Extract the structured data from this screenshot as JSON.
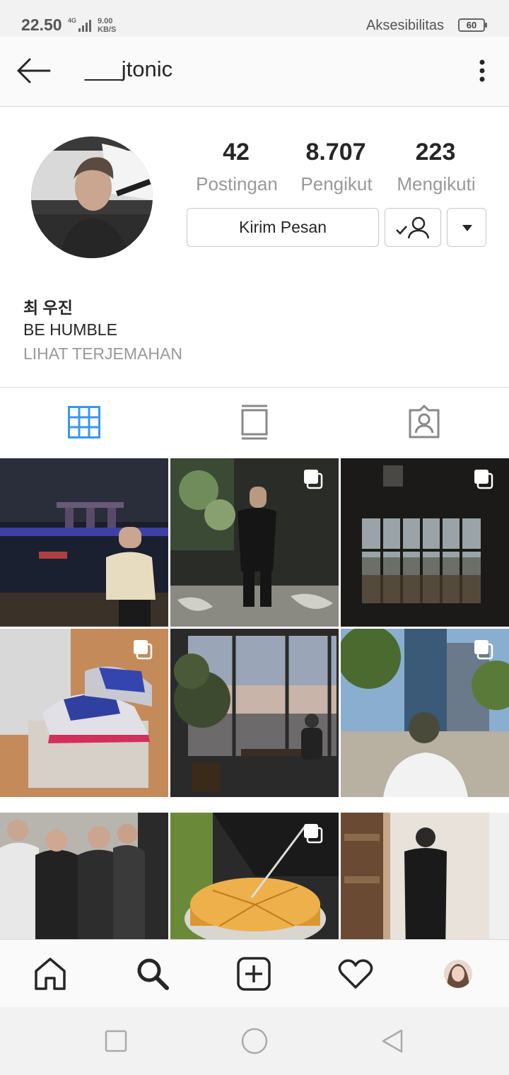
{
  "status_bar": {
    "time": "22.50",
    "network_type": "4G",
    "speed_value": "9.00",
    "speed_unit": "KB/S",
    "accessibility_label": "Aksesibilitas",
    "battery": "60"
  },
  "header": {
    "username": "___jtonic"
  },
  "profile": {
    "stats": [
      {
        "value": "42",
        "label": "Postingan"
      },
      {
        "value": "8.707",
        "label": "Pengikut"
      },
      {
        "value": "223",
        "label": "Mengikuti"
      }
    ],
    "message_button": "Kirim Pesan",
    "name": "최 우진",
    "bio": "BE HUMBLE",
    "translate_link": "LIHAT TERJEMAHAN"
  },
  "tabs": [
    {
      "icon": "grid-icon",
      "active": true
    },
    {
      "icon": "feed-icon",
      "active": false
    },
    {
      "icon": "tagged-icon",
      "active": false
    }
  ],
  "colors": {
    "accent_blue": "#3897f0",
    "text": "#262626",
    "muted": "#999999",
    "border": "#dbdbdb"
  },
  "posts": [
    {
      "scene": "night city harbor",
      "multi": false
    },
    {
      "scene": "mirror selfie suit",
      "multi": true
    },
    {
      "scene": "dark bar window",
      "multi": true
    },
    {
      "scene": "sneakers on box",
      "multi": true
    },
    {
      "scene": "window city view",
      "multi": false
    },
    {
      "scene": "street back view",
      "multi": true
    },
    {
      "scene": "group of friends",
      "multi": false
    },
    {
      "scene": "cutting crepe cake",
      "multi": true
    },
    {
      "scene": "mirror selfie doorway",
      "multi": false
    }
  ],
  "bottom_nav": [
    "home-icon",
    "search-icon",
    "new-post-icon",
    "activity-icon",
    "profile-avatar"
  ]
}
